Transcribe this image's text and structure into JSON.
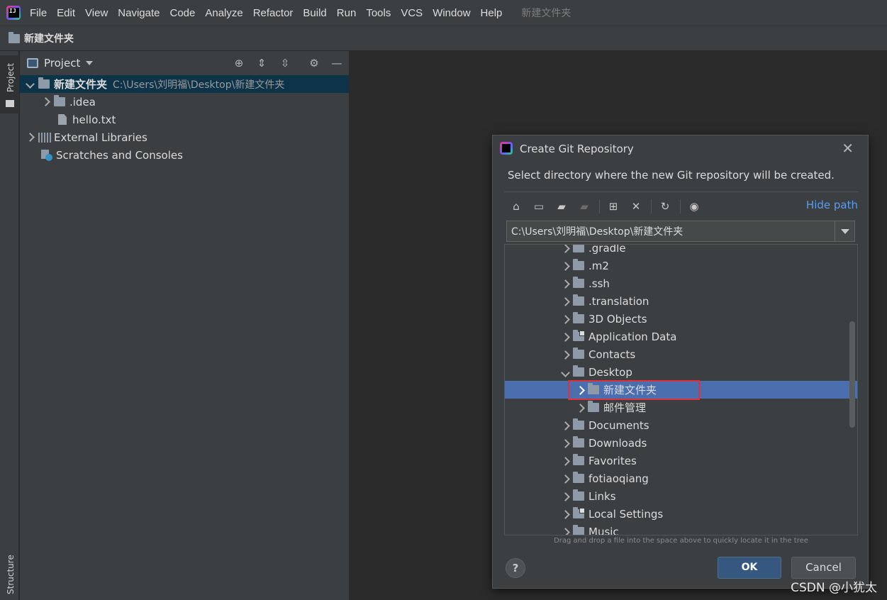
{
  "menubar": {
    "items": [
      "File",
      "Edit",
      "View",
      "Navigate",
      "Code",
      "Analyze",
      "Refactor",
      "Build",
      "Run",
      "Tools",
      "VCS",
      "Window",
      "Help"
    ],
    "project_title": "新建文件夹"
  },
  "navbar": {
    "label": "新建文件夹"
  },
  "left_strip": {
    "project_tab": "Project",
    "structure_tab": "Structure"
  },
  "project_panel": {
    "title": "Project",
    "tree": [
      {
        "label": "新建文件夹",
        "hint": "C:\\Users\\刘明福\\Desktop\\新建文件夹"
      },
      {
        "label": ".idea"
      },
      {
        "label": "hello.txt"
      },
      {
        "label": "External Libraries"
      },
      {
        "label": "Scratches and Consoles"
      }
    ]
  },
  "dialog": {
    "title": "Create Git Repository",
    "description": "Select directory where the new Git repository will be created.",
    "hide_path": "Hide path",
    "path_value": "C:\\Users\\刘明福\\Desktop\\新建文件夹",
    "tree": [
      {
        "label": ".gradle"
      },
      {
        "label": ".m2"
      },
      {
        "label": ".ssh"
      },
      {
        "label": ".translation"
      },
      {
        "label": "3D Objects"
      },
      {
        "label": "Application Data"
      },
      {
        "label": "Contacts"
      },
      {
        "label": "Desktop"
      },
      {
        "label": "新建文件夹"
      },
      {
        "label": "邮件管理"
      },
      {
        "label": "Documents"
      },
      {
        "label": "Downloads"
      },
      {
        "label": "Favorites"
      },
      {
        "label": "fotiaoqiang"
      },
      {
        "label": "Links"
      },
      {
        "label": "Local Settings"
      },
      {
        "label": "Music"
      }
    ],
    "hint": "Drag and drop a file into the space above to quickly locate it in the tree",
    "help_label": "?",
    "ok_label": "OK",
    "cancel_label": "Cancel"
  },
  "watermark": "CSDN @小犹太"
}
